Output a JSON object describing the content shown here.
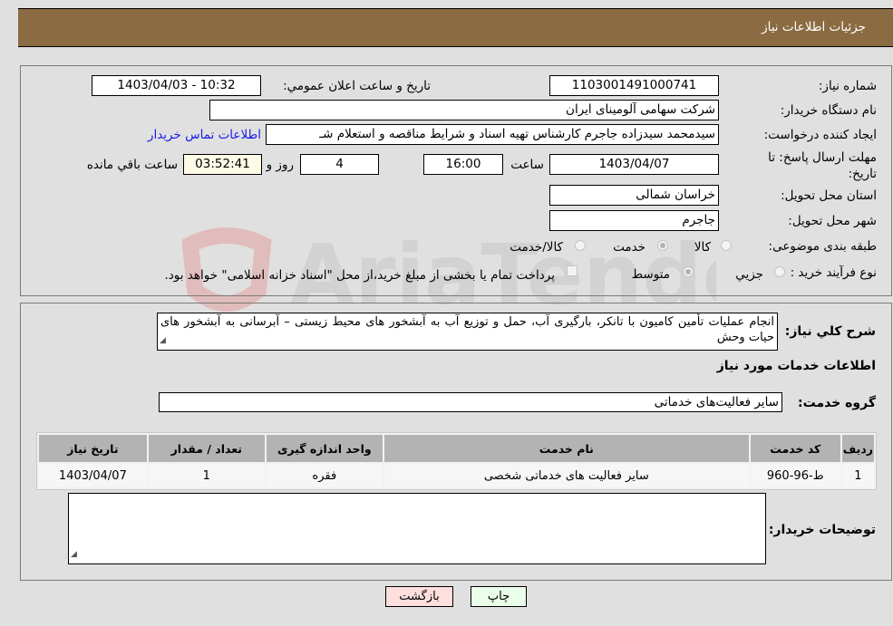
{
  "header": {
    "title": "جزئیات اطلاعات نیاز"
  },
  "details": {
    "need_number_label": "شماره نیاز:",
    "need_number": "1103001491000741",
    "announce_label": "تاریخ و ساعت اعلان عمومي:",
    "announce_value": "1403/04/03 - 10:32",
    "buyer_org_label": "نام دستگاه خریدار:",
    "buyer_org": "شرکت سهامی آلومینای ایران",
    "creator_label": "ایجاد کننده درخواست:",
    "creator": "سیدمحمد سیدزاده جاجرم کارشناس تهیه اسناد و شرایط  مناقصه و استعلام شـ",
    "buyer_contact_link": "اطلاعات تماس خریدار",
    "deadline_label": "مهلت ارسال پاسخ: تا تاریخ:",
    "deadline_date": "1403/04/07",
    "time_label": "ساعت",
    "deadline_time": "16:00",
    "days_value": "4",
    "days_label": "روز و",
    "remaining_time": "03:52:41",
    "remaining_label": "ساعت باقي مانده",
    "province_label": "استان محل تحویل:",
    "province": "خراسان شمالی",
    "city_label": "شهر محل تحویل:",
    "city": "جاجرم",
    "category_label": "طبقه بندی موضوعی:",
    "category_options": [
      {
        "label": "کالا",
        "checked": false
      },
      {
        "label": "خدمت",
        "checked": true
      },
      {
        "label": "کالا/خدمت",
        "checked": false
      }
    ],
    "process_label": "نوع فرآیند خرید :",
    "process_options": [
      {
        "label": "جزيي",
        "checked": false
      },
      {
        "label": "متوسط",
        "checked": true
      }
    ],
    "treasury_checkbox_label": "پرداخت تمام یا بخشی از مبلغ خرید،از محل \"اسناد خزانه اسلامی\" خواهد بود.",
    "treasury_checked": false
  },
  "services": {
    "description_label": "شرح کلي نیاز:",
    "description": "انجام عملیات تأمین کامیون با تانکر، بارگیری آب، حمل و توزیع آب به آبشخور های محیط زیستی – آبرسانی به آبشخور های حیات وحش",
    "section_title": "اطلاعات خدمات مورد نیاز",
    "group_label": "گروه خدمت:",
    "group_value": "سایر فعالیت‌های خدماتی",
    "table": {
      "columns": [
        "ردیف",
        "کد خدمت",
        "نام خدمت",
        "واحد اندازه گیری",
        "تعداد / مقدار",
        "تاریخ نیاز"
      ],
      "rows": [
        [
          "1",
          "ط-96-960",
          "سایر فعالیت های خدماتی شخصی",
          "فقره",
          "1",
          "1403/04/07"
        ]
      ]
    },
    "buyer_notes_label": "توضیحات خریدار:",
    "buyer_notes": ""
  },
  "buttons": {
    "print": "چاپ",
    "back": "بازگشت"
  },
  "colors": {
    "header_bg": "#8b6b42",
    "link": "#1a1ae6",
    "print_bg": "#eaffea",
    "back_bg": "#ffdede"
  }
}
